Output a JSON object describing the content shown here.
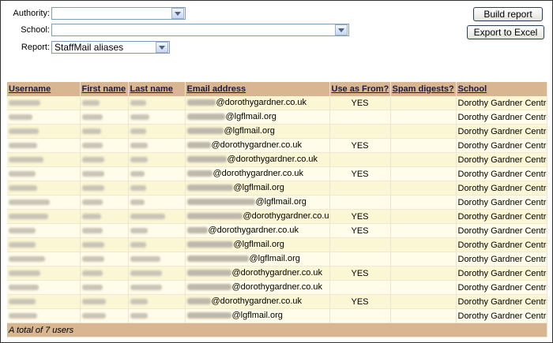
{
  "filters": {
    "authority_label": "Authority:",
    "authority_value": "",
    "school_label": "School:",
    "school_value": "",
    "report_label": "Report:",
    "report_value": "StaffMail aliases"
  },
  "buttons": {
    "build_report": "Build report",
    "export_excel": "Export to Excel"
  },
  "table": {
    "headers": [
      "Username",
      "First name",
      "Last name",
      "Email address",
      "Use as From?",
      "Spam digests?",
      "School"
    ],
    "rows": [
      {
        "domain": "@dorothygardner.co.uk",
        "use_as_from": "YES",
        "school": "Dorothy Gardner Centre"
      },
      {
        "domain": "@lgflmail.org",
        "use_as_from": "",
        "school": "Dorothy Gardner Centre"
      },
      {
        "domain": "@lgflmail.org",
        "use_as_from": "",
        "school": "Dorothy Gardner Centre"
      },
      {
        "domain": "@dorothygardner.co.uk",
        "use_as_from": "YES",
        "school": "Dorothy Gardner Centre"
      },
      {
        "domain": "@dorothygardner.co.uk",
        "use_as_from": "",
        "school": "Dorothy Gardner Centre"
      },
      {
        "domain": "@dorothygardner.co.uk",
        "use_as_from": "YES",
        "school": "Dorothy Gardner Centre"
      },
      {
        "domain": "@lgflmail.org",
        "use_as_from": "",
        "school": "Dorothy Gardner Centre"
      },
      {
        "domain": "@lgflmail.org",
        "use_as_from": "",
        "school": "Dorothy Gardner Centre"
      },
      {
        "domain": "@dorothygardner.co.uk",
        "use_as_from": "YES",
        "school": "Dorothy Gardner Centre"
      },
      {
        "domain": "@dorothygardner.co.uk",
        "use_as_from": "YES",
        "school": "Dorothy Gardner Centre"
      },
      {
        "domain": "@lgflmail.org",
        "use_as_from": "",
        "school": "Dorothy Gardner Centre"
      },
      {
        "domain": "@lgflmail.org",
        "use_as_from": "",
        "school": "Dorothy Gardner Centre"
      },
      {
        "domain": "@dorothygardner.co.uk",
        "use_as_from": "YES",
        "school": "Dorothy Gardner Centre"
      },
      {
        "domain": "@dorothygardner.co.uk",
        "use_as_from": "",
        "school": "Dorothy Gardner Centre"
      },
      {
        "domain": "@dorothygardner.co.uk",
        "use_as_from": "YES",
        "school": "Dorothy Gardner Centre"
      },
      {
        "domain": "@lgflmail.org",
        "use_as_from": "",
        "school": "Dorothy Gardner Centre"
      }
    ],
    "footer": "A total of 7 users"
  }
}
